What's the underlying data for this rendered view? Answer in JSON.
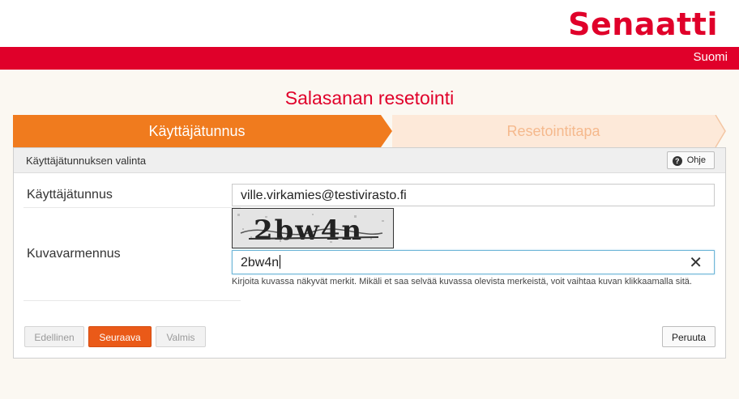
{
  "header": {
    "logo_text": "Senaatti",
    "language": "Suomi"
  },
  "page_title": "Salasanan resetointi",
  "wizard": {
    "steps": [
      {
        "label": "Käyttäjätunnus",
        "active": true
      },
      {
        "label": "Resetointitapa",
        "active": false
      }
    ]
  },
  "panel": {
    "title": "Käyttäjätunnuksen valinta",
    "help_label": "Ohje"
  },
  "form": {
    "username_label": "Käyttäjätunnus",
    "username_value": "ville.virkamies@testivirasto.fi",
    "captcha_label": "Kuvavarmennus",
    "captcha_image_text": "2bw4n",
    "captcha_value": "2bw4n",
    "captcha_hint": "Kirjoita kuvassa näkyvät merkit. Mikäli et saa selvää kuvassa olevista merkeistä, voit vaihtaa kuvan klikkaamalla sitä."
  },
  "buttons": {
    "previous": "Edellinen",
    "next": "Seuraava",
    "done": "Valmis",
    "cancel": "Peruuta"
  },
  "colors": {
    "brand_red": "#e0002a",
    "step_active": "#f07b1e",
    "step_inactive": "#fde9d9",
    "next_button": "#ea5a18"
  }
}
